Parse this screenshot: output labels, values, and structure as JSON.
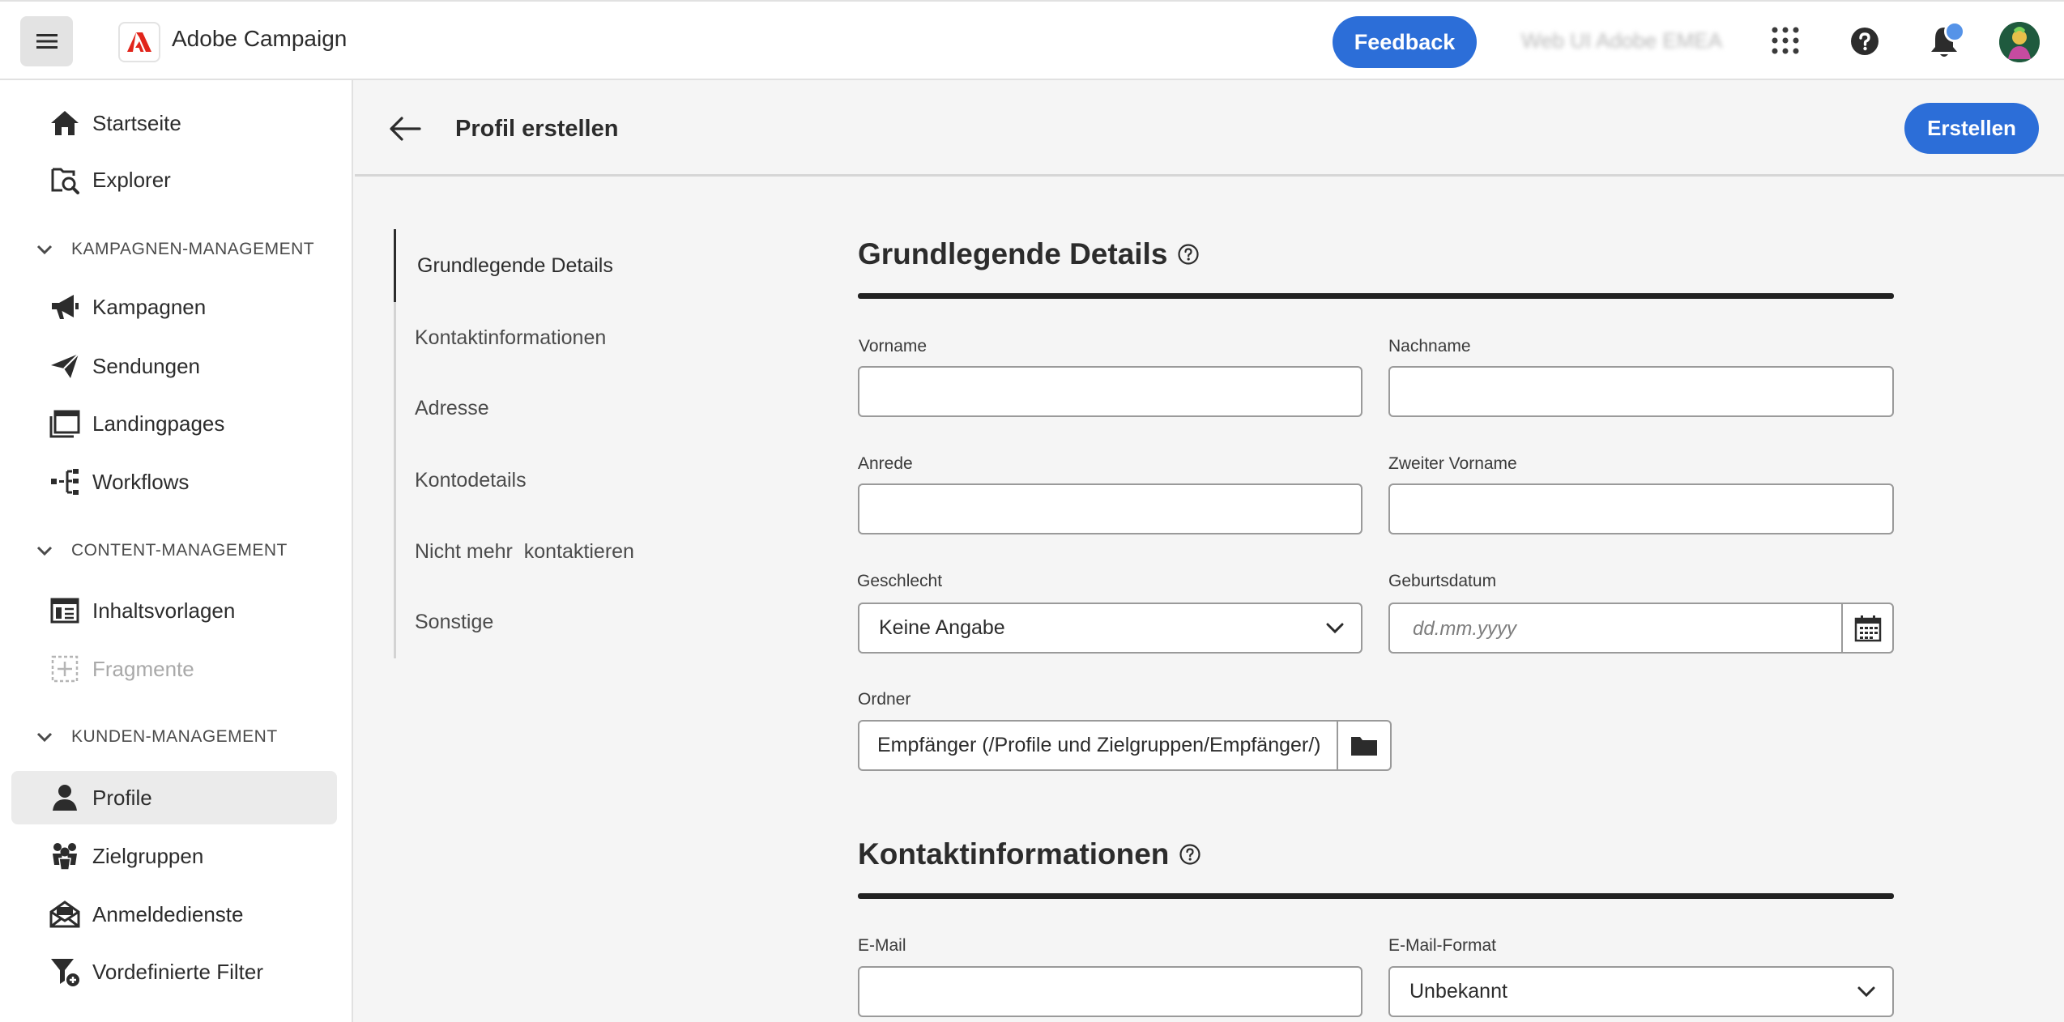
{
  "app": {
    "name": "Adobe Campaign",
    "feedback_label": "Feedback",
    "org_name": "Web UI Adobe EMEA",
    "brand_color": "#2c6ed8"
  },
  "sidebar": {
    "top_items": [
      {
        "label": "Startseite",
        "icon": "home-icon"
      },
      {
        "label": "Explorer",
        "icon": "explorer-icon"
      }
    ],
    "sections": [
      {
        "title": "KAMPAGNEN-MANAGEMENT",
        "items": [
          {
            "label": "Kampagnen",
            "icon": "megaphone-icon"
          },
          {
            "label": "Sendungen",
            "icon": "send-icon"
          },
          {
            "label": "Landingpages",
            "icon": "landing-page-icon"
          },
          {
            "label": "Workflows",
            "icon": "workflow-icon"
          }
        ]
      },
      {
        "title": "CONTENT-MANAGEMENT",
        "items": [
          {
            "label": "Inhaltsvorlagen",
            "icon": "template-icon"
          },
          {
            "label": "Fragmente",
            "icon": "fragment-icon",
            "disabled": true
          }
        ]
      },
      {
        "title": "KUNDEN-MANAGEMENT",
        "items": [
          {
            "label": "Profile",
            "icon": "person-icon",
            "active": true
          },
          {
            "label": "Zielgruppen",
            "icon": "audience-icon"
          },
          {
            "label": "Anmeldedienste",
            "icon": "subscription-icon"
          },
          {
            "label": "Vordefinierte Filter",
            "icon": "filter-icon"
          }
        ]
      }
    ]
  },
  "header": {
    "title": "Profil erstellen",
    "create_label": "Erstellen"
  },
  "tabs": [
    {
      "label": "Grundlegende Details",
      "active": true
    },
    {
      "label": "Kontaktinformationen"
    },
    {
      "label": "Adresse"
    },
    {
      "label": "Kontodetails"
    },
    {
      "label": "Nicht mehr  kontaktieren"
    },
    {
      "label": "Sonstige"
    }
  ],
  "form": {
    "basic": {
      "title": "Grundlegende Details",
      "first_name_label": "Vorname",
      "first_name_value": "",
      "last_name_label": "Nachname",
      "last_name_value": "",
      "salutation_label": "Anrede",
      "salutation_value": "",
      "middle_name_label": "Zweiter Vorname",
      "middle_name_value": "",
      "gender_label": "Geschlecht",
      "gender_value": "Keine Angabe",
      "birthdate_label": "Geburtsdatum",
      "birthdate_placeholder": "dd.mm.yyyy",
      "folder_label": "Ordner",
      "folder_value": "Empfänger (/Profile und Zielgruppen/Empfänger/)"
    },
    "contact": {
      "title": "Kontaktinformationen",
      "email_label": "E-Mail",
      "email_value": "",
      "email_format_label": "E-Mail-Format",
      "email_format_value": "Unbekannt"
    }
  }
}
